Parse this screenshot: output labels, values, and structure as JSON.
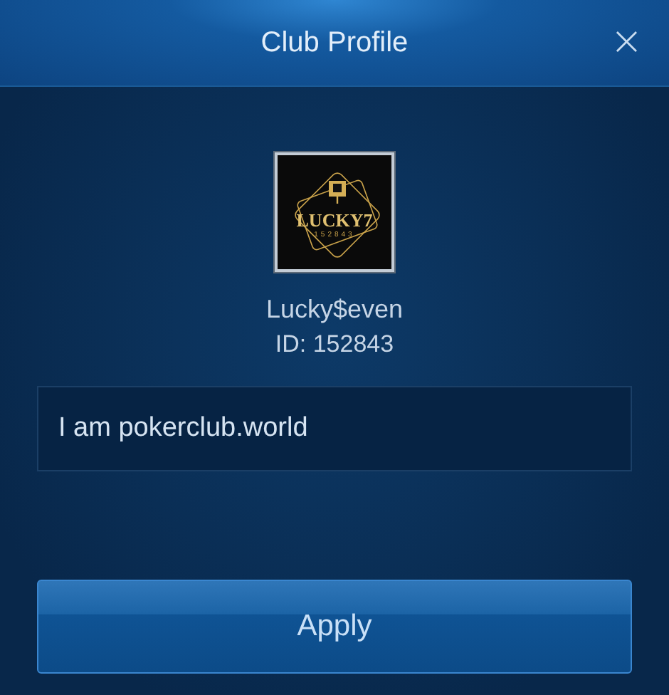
{
  "window": {
    "title": "Club Profile",
    "close": "×"
  },
  "club": {
    "logo": {
      "name": "LUCKY7",
      "code": "152843"
    },
    "name": "Lucky$even",
    "id": "ID: 152843"
  },
  "description": {
    "value": "I am pokerclub.world"
  },
  "buttons": [
    "Apply"
  ]
}
